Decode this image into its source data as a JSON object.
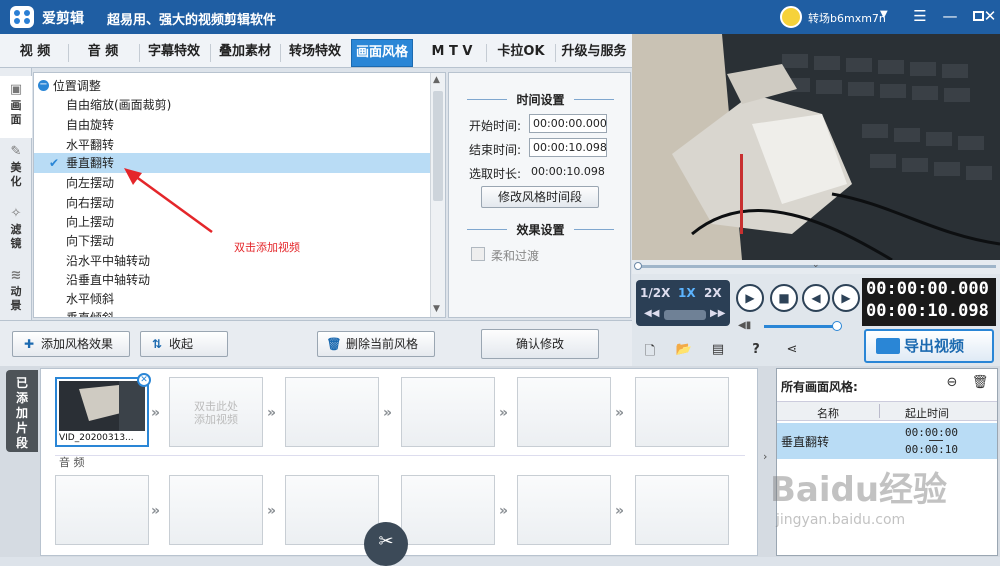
{
  "app": {
    "name": "爱剪辑",
    "slogan": "超易用、强大的视频剪辑软件",
    "user": "转场b6mxm7n",
    "window_buttons": [
      "menu-icon",
      "minimize-icon",
      "maximize-icon",
      "close-icon"
    ]
  },
  "tabs": [
    {
      "label": "视 频"
    },
    {
      "label": "音 频"
    },
    {
      "label": "字幕特效"
    },
    {
      "label": "叠加素材"
    },
    {
      "label": "转场特效"
    },
    {
      "label": "画面风格",
      "active": true
    },
    {
      "label": "M T V"
    },
    {
      "label": "卡拉OK"
    },
    {
      "label": "升级与服务"
    }
  ],
  "sidebar": [
    {
      "label": "画面",
      "active": true
    },
    {
      "label": "美化"
    },
    {
      "label": "滤镜"
    },
    {
      "label": "动景"
    }
  ],
  "effects": {
    "category": "位置调整",
    "items": [
      "自由缩放(画面裁剪)",
      "自由旋转",
      "水平翻转",
      "垂直翻转",
      "向左摆动",
      "向右摆动",
      "向上摆动",
      "向下摆动",
      "沿水平中轴转动",
      "沿垂直中轴转动",
      "水平倾斜",
      "垂直倾斜"
    ],
    "selected": "垂直翻转"
  },
  "annotation": "双击添加视频",
  "settings": {
    "time_section": "时间设置",
    "start_label": "开始时间:",
    "start_value": "00:00:00.000",
    "end_label": "结束时间:",
    "end_value": "00:00:10.098",
    "duration_label": "选取时长:",
    "duration_value": "00:00:10.098",
    "modify_time_button": "修改风格时间段",
    "effect_section": "效果设置",
    "smooth_label": "柔和过渡",
    "confirm_button": "确认修改"
  },
  "actions": {
    "add": "添加风格效果",
    "collapse": "收起",
    "delete": "删除当前风格"
  },
  "player": {
    "speeds": [
      "1/2X",
      "1X",
      "2X"
    ],
    "active_speed": "1X",
    "current_time": "00:00:00.000",
    "total_time": "00:00:10.098",
    "progress": 0.0,
    "volume": 0.95
  },
  "toolbar_icons": [
    "new-project-icon",
    "open-folder-icon",
    "save-icon",
    "help-icon",
    "share-icon"
  ],
  "export_label": "导出视频",
  "clips_tab": "已添加片段",
  "clip": {
    "name": "VID_20200313..."
  },
  "timeline_hint": "双击此处\n添加视频",
  "audio_label": "音 频",
  "right_panel": {
    "title": "所有画面风格:",
    "col_name": "名称",
    "col_time": "起止时间",
    "row": {
      "name": "垂直翻转",
      "start": "00:00:00",
      "end": "00:00:10"
    }
  },
  "watermark": {
    "main": "Baidu经验",
    "sub": "jingyan.baidu.com"
  },
  "colors": {
    "titlebar": "#1f5ea3",
    "accent": "#2a86d6",
    "annotation": "#e4262a",
    "selection": "#b9dcf5"
  }
}
